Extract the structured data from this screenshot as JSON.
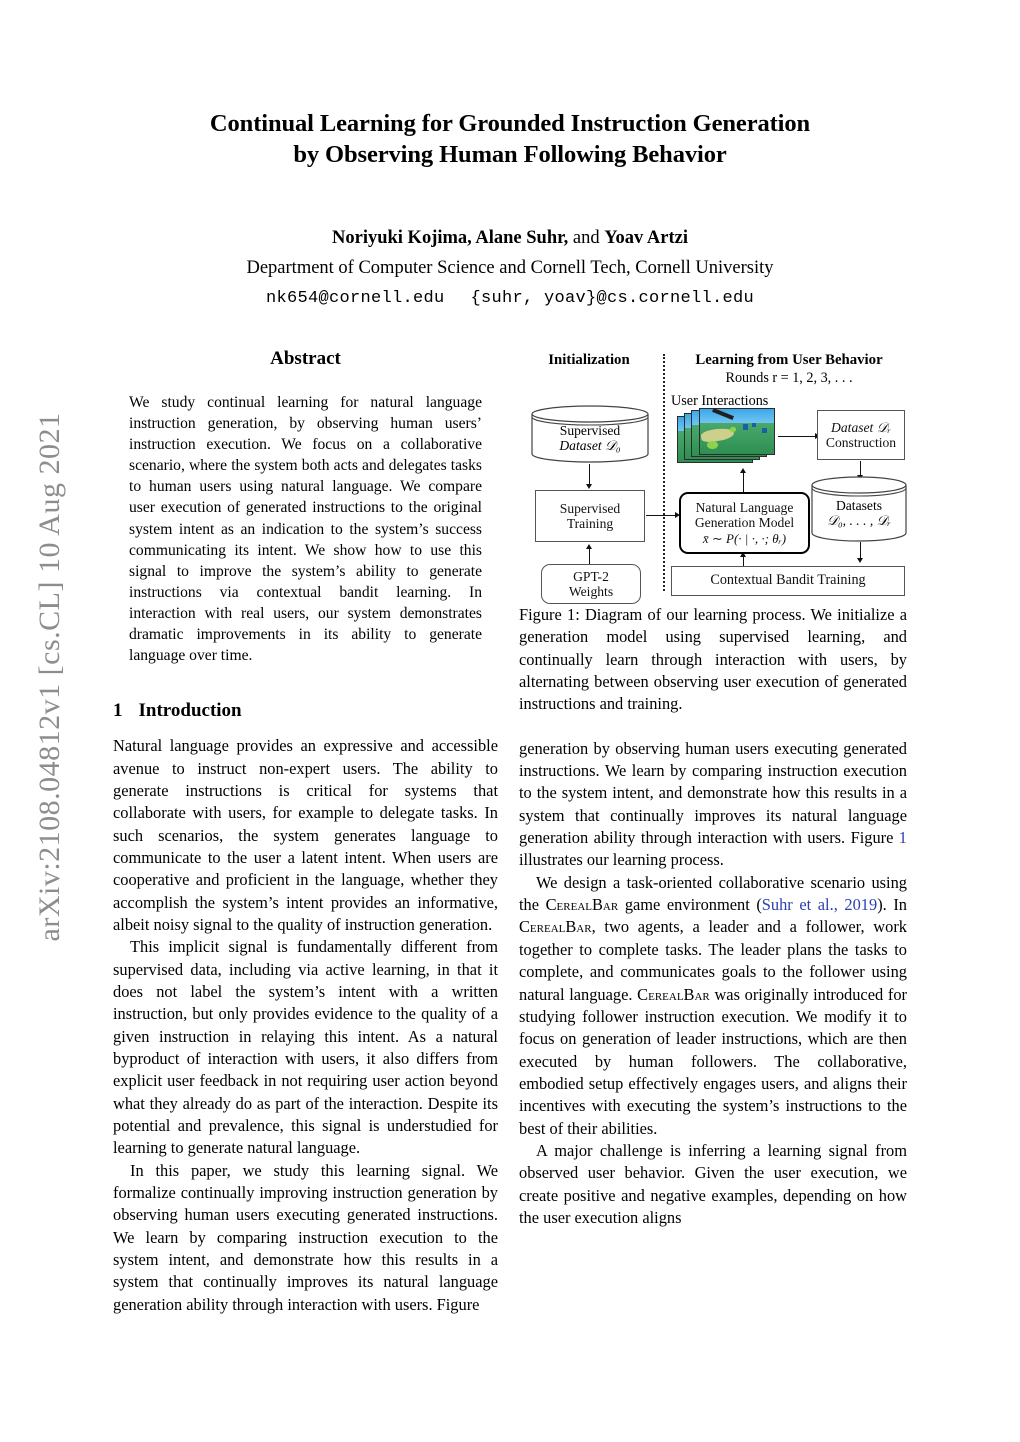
{
  "arxiv_stamp": "arXiv:2108.04812v1  [cs.CL]  10 Aug 2021",
  "title": {
    "line1": "Continual Learning for Grounded Instruction Generation",
    "line2": "by Observing Human Following Behavior"
  },
  "authors": {
    "name1": "Noriyuki Kojima, Alane Suhr,",
    "conjunction": " and ",
    "name2": "Yoav Artzi",
    "affiliation": "Department of Computer Science and Cornell Tech, Cornell University",
    "email1": "nk654@cornell.edu",
    "email2": "{suhr, yoav}@cs.cornell.edu"
  },
  "abstract": {
    "heading": "Abstract",
    "text": "We study continual learning for natural language instruction generation, by observing human users’ instruction execution. We focus on a collaborative scenario, where the system both acts and delegates tasks to human users using natural language. We compare user execution of generated instructions to the original system intent as an indication to the system’s success communicating its intent. We show how to use this signal to improve the system’s ability to generate instructions via contextual bandit learning. In interaction with real users, our system demonstrates dramatic improvements in its ability to generate language over time."
  },
  "introduction": {
    "number": "1",
    "heading": "Introduction",
    "para1": "Natural language provides an expressive and accessible avenue to instruct non-expert users. The ability to generate instructions is critical for systems that collaborate with users, for example to delegate tasks. In such scenarios, the system generates language to communicate to the user a latent intent. When users are cooperative and proficient in the language, whether they accomplish the system’s intent provides an informative, albeit noisy signal to the quality of instruction generation.",
    "para2": "This implicit signal is fundamentally different from supervised data, including via active learning, in that it does not label the system’s intent with a written instruction, but only provides evidence to the quality of a given instruction in relaying this intent. As a natural byproduct of interaction with users, it also differs from explicit user feedback in not requiring user action beyond what they already do as part of the interaction. Despite its potential and prevalence, this signal is understudied for learning to generate natural language.",
    "para3_start": "In this paper, we study this learning signal. We formalize continually improving instruction generation by observing human users executing generated instructions. We learn by comparing instruction execution to the system intent, and demonstrate how this results in a system that continually improves its natural language generation ability through interaction with users. Figure ",
    "para3_ref": "1",
    "para3_end": " illustrates our learning process.",
    "para4_a": "We design a task-oriented collaborative scenario using the ",
    "para4_sc1": "CerealBar",
    "para4_b": " game environment (",
    "para4_cite": "Suhr et al., 2019",
    "para4_c": "). In ",
    "para4_sc2": "CerealBar",
    "para4_d": ", two agents, a leader and a follower, work together to complete tasks. The leader plans the tasks to complete, and communicates goals to the follower using natural language. ",
    "para4_sc3": "CerealBar",
    "para4_e": " was originally introduced for studying follower instruction execution. We modify it to focus on generation of leader instructions, which are then executed by human followers. The collaborative, embodied setup effectively engages users, and aligns their incentives with executing the system’s instructions to the best of their abilities.",
    "para5": "A major challenge is inferring a learning signal from observed user behavior. Given the user execution, we create positive and negative examples, depending on how the user execution aligns"
  },
  "figure": {
    "caption": "Figure 1: Diagram of our learning process. We initialize a generation model using supervised learning, and continually learn through interaction with users, by alternating between observing user execution of generated instructions and training.",
    "diagram": {
      "left_title": "Initialization",
      "right_title": "Learning from User Behavior",
      "right_subtitle": "Rounds r = 1, 2, 3, . . .",
      "user_interactions_label": "User Interactions",
      "supervised_dataset_l1": "Supervised",
      "supervised_dataset_l2": "Dataset 𝒟₀",
      "supervised_training_l1": "Supervised",
      "supervised_training_l2": "Training",
      "gpt2_l1": "GPT-2",
      "gpt2_l2": "Weights",
      "nlg_l1": "Natural Language",
      "nlg_l2": "Generation Model",
      "nlg_formula": "x̄ ∼ P(· | ·, ·; θᵣ)",
      "dataset_construction_l1": "Dataset 𝒟ᵣ",
      "dataset_construction_l2": "Construction",
      "datasets_l1": "Datasets",
      "datasets_l2": "𝒟₀, . . . , 𝒟ᵣ",
      "bandit_training": "Contextual Bandit Training"
    }
  }
}
